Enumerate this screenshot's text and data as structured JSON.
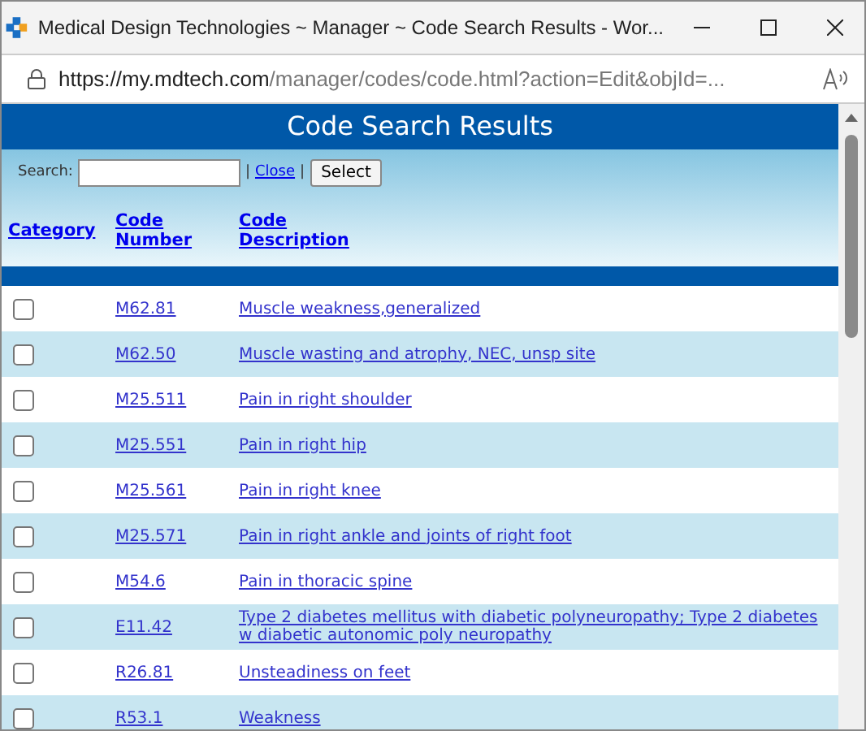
{
  "window": {
    "title": "Medical Design Technologies ~ Manager ~ Code Search Results - Wor..."
  },
  "address_bar": {
    "url_host": "https://my.mdtech.com",
    "url_path": "/manager/codes/code.html?action=Edit&objId=..."
  },
  "page": {
    "title": "Code Search Results"
  },
  "search": {
    "label": "Search:",
    "close_link": "Close",
    "select_button": "Select",
    "separator_1": "|",
    "separator_2": "|"
  },
  "table": {
    "columns": [
      "Category",
      "Code Number",
      "Code Description"
    ],
    "rows": [
      {
        "checked": false,
        "code": "M62.81",
        "description": "Muscle weakness,generalized"
      },
      {
        "checked": false,
        "code": "M62.50",
        "description": "Muscle wasting and atrophy, NEC, unsp site"
      },
      {
        "checked": false,
        "code": "M25.511",
        "description": "Pain in right shoulder"
      },
      {
        "checked": false,
        "code": "M25.551",
        "description": "Pain in right hip"
      },
      {
        "checked": false,
        "code": "M25.561",
        "description": "Pain in right knee"
      },
      {
        "checked": false,
        "code": "M25.571",
        "description": "Pain in right ankle and joints of right foot"
      },
      {
        "checked": false,
        "code": "M54.6",
        "description": "Pain in thoracic spine"
      },
      {
        "checked": false,
        "code": "E11.42",
        "description": "Type 2 diabetes mellitus with diabetic polyneuropathy; Type 2 diabetes w diabetic autonomic poly neuropathy"
      },
      {
        "checked": false,
        "code": "R26.81",
        "description": "Unsteadiness on feet"
      },
      {
        "checked": false,
        "code": "R53.1",
        "description": "Weakness"
      }
    ]
  }
}
